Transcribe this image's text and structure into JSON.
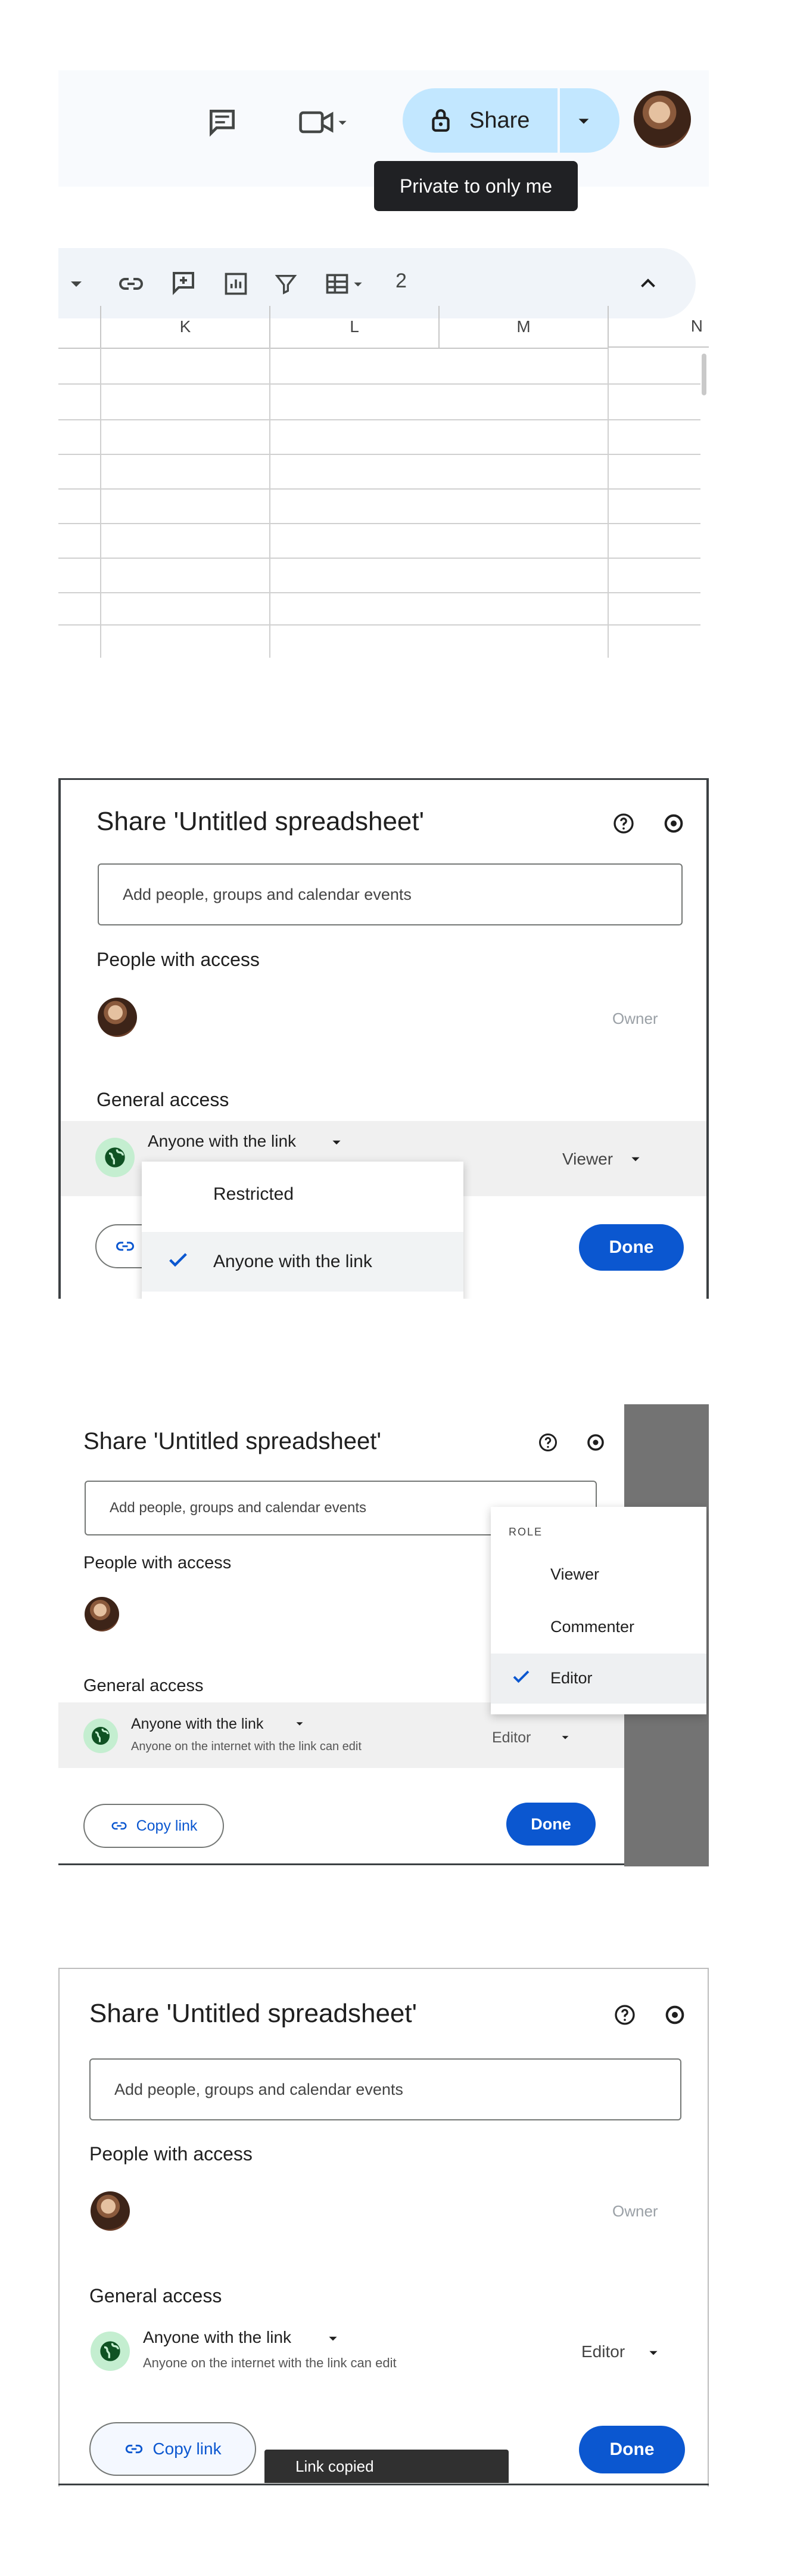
{
  "screen1": {
    "toolbar": {
      "share_label": "Share",
      "tooltip": "Private to only me",
      "number_format_label": "2"
    },
    "columns": [
      "K",
      "L",
      "M",
      "N"
    ]
  },
  "dialog_common": {
    "title": "Share 'Untitled spreadsheet'",
    "add_placeholder": "Add people, groups and calendar events",
    "people_heading": "People with access",
    "general_heading": "General access",
    "owner_label": "Owner",
    "access_anyone": "Anyone with the link",
    "done_label": "Done",
    "copy_link_label": "Copy link"
  },
  "screen2": {
    "role_label": "Viewer",
    "menu": {
      "items": [
        "Restricted",
        "Anyone with the link"
      ],
      "selected": "Anyone with the link"
    }
  },
  "screen3": {
    "access_description": "Anyone on the internet with the link can edit",
    "role_label": "Editor",
    "role_menu": {
      "heading": "ROLE",
      "items": [
        "Viewer",
        "Commenter",
        "Editor"
      ],
      "selected": "Editor"
    }
  },
  "screen4": {
    "access_description": "Anyone on the internet with the link can edit",
    "role_label": "Editor",
    "snackbar": "Link copied"
  },
  "colors": {
    "accent": "#0b57d0",
    "share_button_bg": "#c2e7ff",
    "globe_bg": "#c4eed0",
    "globe_fg": "#0f5223"
  },
  "icons": [
    "comment-icon",
    "video-call-icon",
    "lock-icon",
    "chevron-down-icon",
    "link-icon",
    "insert-comment-icon",
    "chart-icon",
    "filter-icon",
    "table-icon",
    "chevron-up-icon",
    "help-icon",
    "settings-icon",
    "globe-icon",
    "check-icon"
  ]
}
